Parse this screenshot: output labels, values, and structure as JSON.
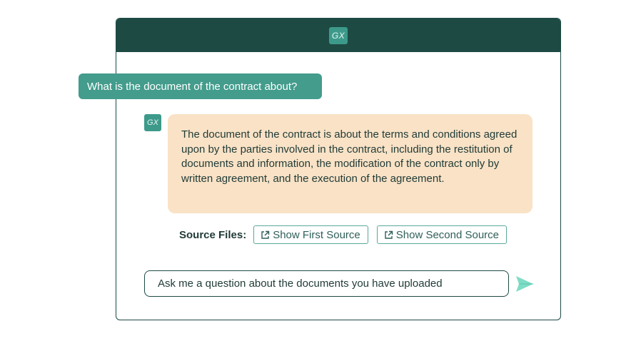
{
  "header": {
    "logo_text": "GX"
  },
  "conversation": {
    "user_message": "What is the document of the contract about?",
    "bot_avatar_text": "GX",
    "bot_message": "The document of the contract is about the terms and conditions agreed upon by the parties involved in the contract, including the restitution of documents and information, the modification of the contract only by written agreement, and the execution of the agreement."
  },
  "sources": {
    "label": "Source Files:",
    "buttons": [
      {
        "label": "Show First Source",
        "icon": "external-link-icon"
      },
      {
        "label": "Show Second Source",
        "icon": "external-link-icon"
      }
    ]
  },
  "composer": {
    "placeholder": "Ask me a question about the documents you have uploaded",
    "send_icon": "send-icon"
  },
  "colors": {
    "header_bg": "#1e4a44",
    "accent": "#439c8c",
    "bot_bubble_bg": "#f9e2c6",
    "send_icon": "#7fdcc5"
  }
}
